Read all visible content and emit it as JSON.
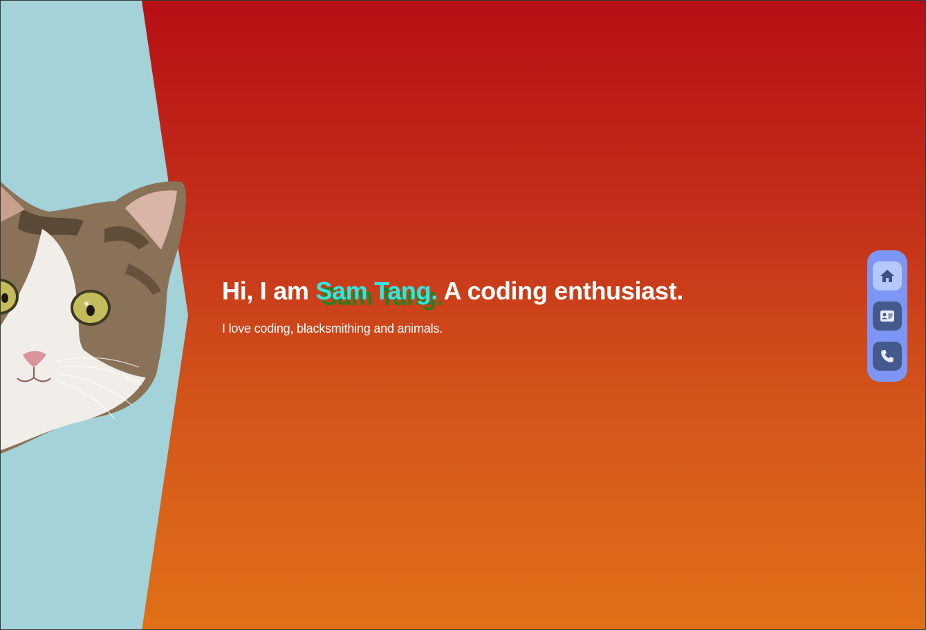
{
  "hero": {
    "greeting": "Hi, I am",
    "name": "Sam Tang.",
    "role": "A coding enthusiast.",
    "tagline": "I love coding, blacksmithing and animals."
  },
  "nav": {
    "items": [
      {
        "icon": "home-icon",
        "active": true
      },
      {
        "icon": "contact-card-icon",
        "active": false
      },
      {
        "icon": "phone-icon",
        "active": false
      }
    ]
  },
  "colors": {
    "background_top": "#b60f14",
    "background_bottom": "#e07018",
    "side_panel": "#a3d2d8",
    "name_accent": "#2ee8e0",
    "name_shadow": "#2e7d1e",
    "nav_bar": "#7d96f5",
    "nav_button": "#44598c",
    "nav_button_active": "#b5c7fb"
  }
}
